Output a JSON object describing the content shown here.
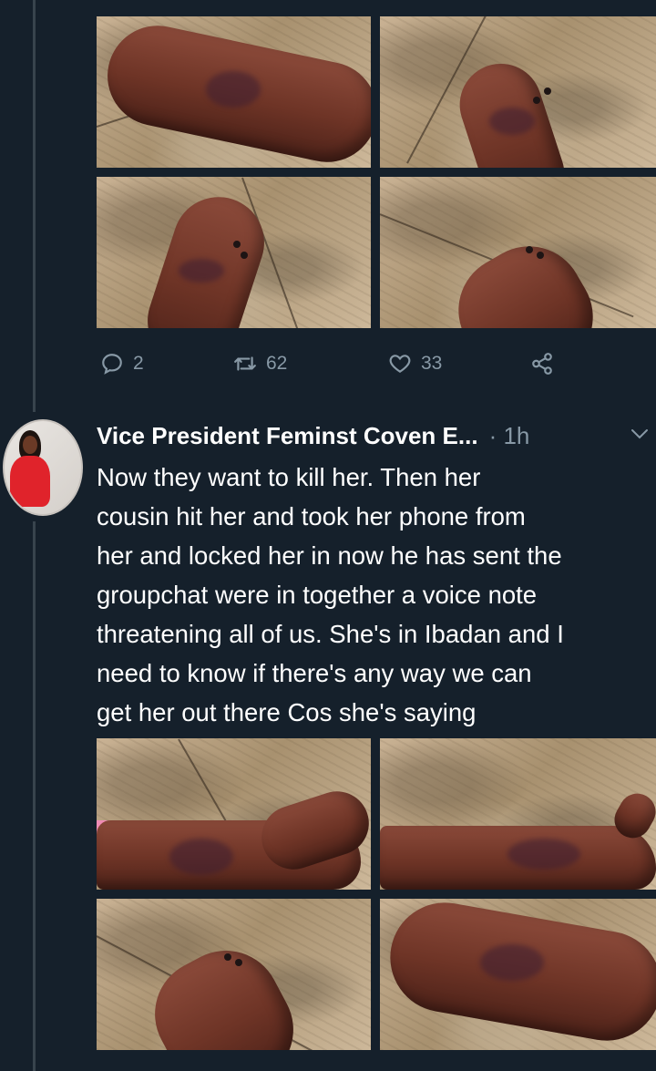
{
  "tweet_actions": {
    "reply_count": "2",
    "retweet_count": "62",
    "like_count": "33"
  },
  "tweet": {
    "author_name": "Vice President Feminst Coven E...",
    "separator": "·",
    "time": "1h",
    "text_lines": [
      "Now  they want to kill her. Then her",
      "cousin hit her and took her phone from",
      "her and locked her in now he has sent the",
      "groupchat were in together a voice note",
      "threatening all of us. She's in Ibadan and I",
      "need to know if there's any way we can",
      "get her out there Cos she's saying"
    ]
  },
  "icons": {
    "reply": "reply-icon",
    "retweet": "retweet-icon",
    "like": "heart-icon",
    "share": "share-icon",
    "menu": "chevron-down-icon"
  },
  "colors": {
    "background": "#15202b",
    "muted_text": "#8899a6",
    "thread_line": "#38444d",
    "primary_text": "#ffffff"
  }
}
